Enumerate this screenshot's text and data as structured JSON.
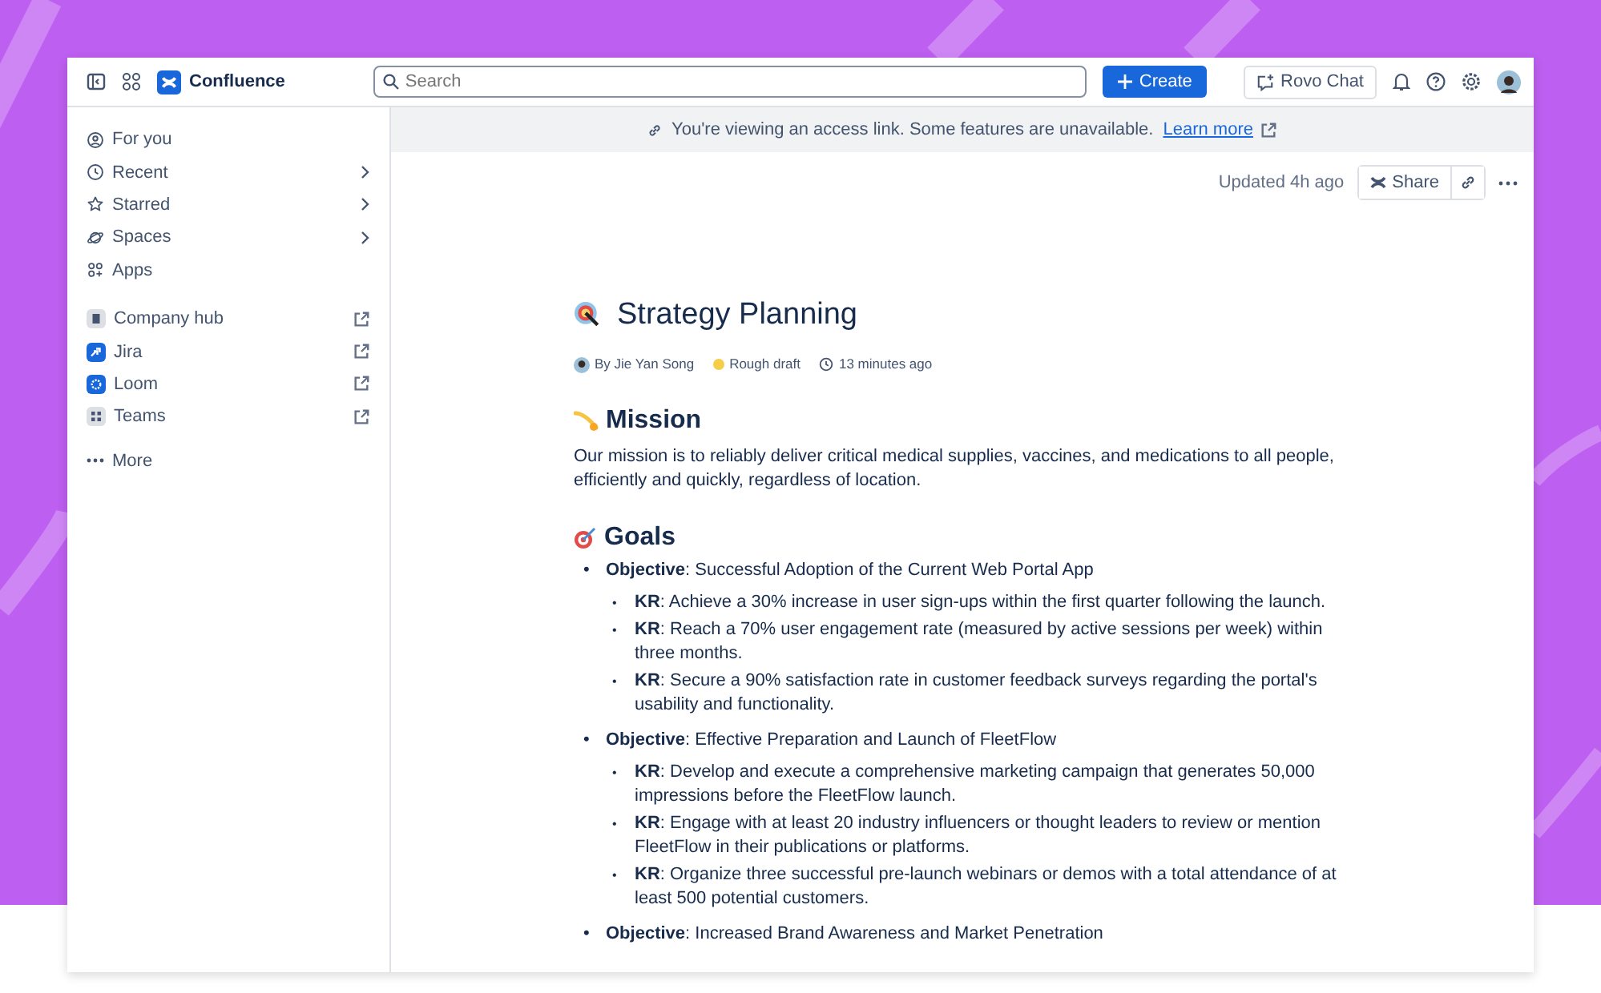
{
  "topbar": {
    "app_name": "Confluence",
    "search": {
      "placeholder": "Search"
    },
    "create_button": "Create",
    "rovo_button": "Rovo Chat"
  },
  "sidebar": {
    "nav": [
      {
        "label": "For you",
        "has_submenu": false
      },
      {
        "label": "Recent",
        "has_submenu": true
      },
      {
        "label": "Starred",
        "has_submenu": true
      },
      {
        "label": "Spaces",
        "has_submenu": true
      },
      {
        "label": "Apps",
        "has_submenu": false
      }
    ],
    "apps": [
      {
        "label": "Company hub",
        "color": "#dcdfe4"
      },
      {
        "label": "Jira",
        "color": "#1868db"
      },
      {
        "label": "Loom",
        "color": "#1868db"
      },
      {
        "label": "Teams",
        "color": "#dcdfe4"
      }
    ],
    "more": "More"
  },
  "banner": {
    "text": "You're viewing an access link. Some features are unavailable.",
    "link": "Learn more"
  },
  "page_actions": {
    "updated": "Updated 4h ago",
    "share": "Share"
  },
  "page": {
    "title": "Strategy Planning",
    "author": "By Jie Yan Song",
    "status": {
      "label": "Rough draft",
      "color": "#f5cd47"
    },
    "time": "13 minutes ago",
    "sections": [
      {
        "heading": "Mission",
        "paragraph": "Our mission is to reliably deliver critical medical supplies, vaccines, and medications to all people, efficiently and quickly, regardless of location."
      },
      {
        "heading": "Goals",
        "objectives": [
          {
            "marker": "•",
            "text": "**Objective**: Successful Adoption of the Current Web Portal App",
            "children": [
              {
                "marker": "•",
                "text": "**KR**: Achieve a 30% increase in user sign-ups within the first quarter following the launch."
              },
              {
                "marker": "•",
                "text": "**KR**: Reach a 70% user engagement rate (measured by active sessions per week) within three months."
              },
              {
                "marker": "•",
                "text": "**KR**: Secure a 90% satisfaction rate in customer feedback surveys regarding the portal's usability and functionality."
              }
            ]
          },
          {
            "marker": "•",
            "text": "**Objective**: Effective Preparation and Launch of FleetFlow",
            "children": [
              {
                "marker": "•",
                "text": "**KR**: Develop and execute a comprehensive marketing campaign that generates 50,000 impressions before the FleetFlow launch."
              },
              {
                "marker": "•",
                "text": "**KR**: Engage with at least 20 industry influencers or thought leaders to review or mention FleetFlow in their publications or platforms."
              },
              {
                "marker": "•",
                "text": "**KR**: Organize three successful pre-launch webinars or demos with a total attendance of at least 500 potential customers."
              }
            ]
          },
          {
            "marker": "•",
            "text": "**Objective**: Increased Brand Awareness and Market Penetration"
          }
        ]
      }
    ]
  }
}
